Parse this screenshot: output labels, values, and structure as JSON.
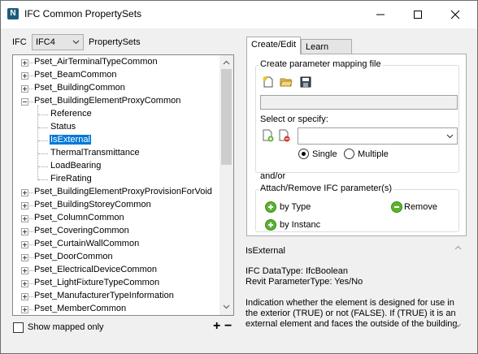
{
  "window": {
    "title": "IFC Common PropertySets",
    "logo_letter": "N"
  },
  "ifc": {
    "label": "IFC",
    "version": "IFC4",
    "propertysets_label": "PropertySets"
  },
  "tree": {
    "items": [
      {
        "label": "Pset_AirTerminalTypeCommon",
        "level": 0,
        "expander": "plus"
      },
      {
        "label": "Pset_BeamCommon",
        "level": 0,
        "expander": "plus"
      },
      {
        "label": "Pset_BuildingCommon",
        "level": 0,
        "expander": "plus"
      },
      {
        "label": "Pset_BuildingElementProxyCommon",
        "level": 0,
        "expander": "minus"
      },
      {
        "label": "Reference",
        "level": 1
      },
      {
        "label": "Status",
        "level": 1
      },
      {
        "label": "IsExternal",
        "level": 1,
        "selected": true
      },
      {
        "label": "ThermalTransmittance",
        "level": 1
      },
      {
        "label": "LoadBearing",
        "level": 1
      },
      {
        "label": "FireRating",
        "level": 1
      },
      {
        "label": "Pset_BuildingElementProxyProvisionForVoid",
        "level": 0,
        "expander": "plus"
      },
      {
        "label": "Pset_BuildingStoreyCommon",
        "level": 0,
        "expander": "plus"
      },
      {
        "label": "Pset_ColumnCommon",
        "level": 0,
        "expander": "plus"
      },
      {
        "label": "Pset_CoveringCommon",
        "level": 0,
        "expander": "plus"
      },
      {
        "label": "Pset_CurtainWallCommon",
        "level": 0,
        "expander": "plus"
      },
      {
        "label": "Pset_DoorCommon",
        "level": 0,
        "expander": "plus"
      },
      {
        "label": "Pset_ElectricalDeviceCommon",
        "level": 0,
        "expander": "plus"
      },
      {
        "label": "Pset_LightFixtureTypeCommon",
        "level": 0,
        "expander": "plus"
      },
      {
        "label": "Pset_ManufacturerTypeInformation",
        "level": 0,
        "expander": "plus"
      },
      {
        "label": "Pset_MemberCommon",
        "level": 0,
        "expander": "plus"
      }
    ]
  },
  "footer": {
    "show_mapped_label": "Show mapped only",
    "show_mapped_checked": false,
    "add_symbol": "+",
    "remove_symbol": "−"
  },
  "tabs": [
    {
      "label": "Create/Edit",
      "active": true
    },
    {
      "label": "Learn more",
      "active": false
    }
  ],
  "create": {
    "group_title": "Create parameter mapping file",
    "file_path": ""
  },
  "select": {
    "label": "Select or specify:",
    "value": "",
    "single_label": "Single",
    "multiple_label": "Multiple",
    "mode": "Single"
  },
  "andor_label": "and/or",
  "attach": {
    "group_title": "Attach/Remove IFC parameter(s)",
    "by_type_label": "by Type",
    "remove_label": "Remove",
    "by_instance_label": "by Instanc"
  },
  "description": {
    "name": "IsExternal",
    "ifc_datatype": "IFC DataType: IfcBoolean",
    "revit_type": "Revit ParameterType: Yes/No",
    "text_lines": [
      "Indication whether the element is designed for use in",
      "the exterior (TRUE) or not (FALSE). If (TRUE) it is an",
      "external element and faces the outside of the building."
    ]
  },
  "colors": {
    "selection": "#0078d7",
    "window_bg": "#f0f0f0",
    "green_button": "#5db32e"
  }
}
